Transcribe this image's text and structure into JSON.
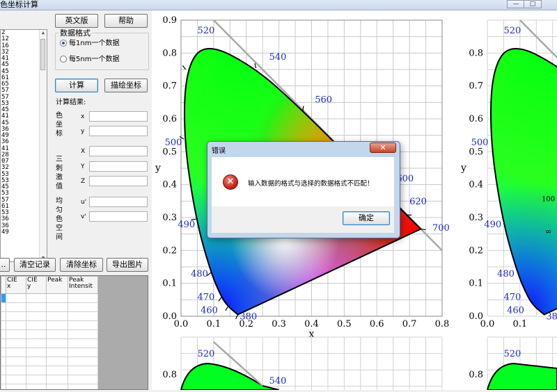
{
  "window": {
    "title": "色坐标计算",
    "controls": [
      "—",
      "□"
    ]
  },
  "data_list": [
    "2",
    "12",
    "16",
    "32",
    "41",
    "45",
    "45",
    "61",
    "65",
    "57",
    "57",
    "53",
    "45",
    "41",
    "45",
    "36",
    "49",
    "36",
    "41",
    "28",
    "07",
    "32",
    "53",
    "53",
    "45",
    "53",
    "57",
    "61",
    "53",
    "36",
    "36",
    "49"
  ],
  "buttons": {
    "english": "英文版",
    "help": "帮助",
    "calculate": "计算",
    "plot": "描绘坐标",
    "left_partial": "..",
    "clear_records": "清空记录",
    "clear_coords": "清除坐标",
    "export_image": "导出图片"
  },
  "data_format": {
    "legend": "数据格式",
    "options": [
      "每1nm一个数据",
      "每5nm一个数据"
    ],
    "selected": 0
  },
  "results": {
    "heading": "计算结果:",
    "groups": [
      {
        "label": "色坐标",
        "fields": [
          "x",
          "y"
        ]
      },
      {
        "label": "三刺激值",
        "fields": [
          "X",
          "Y",
          "Z"
        ]
      },
      {
        "label": "均匀色空间",
        "fields": [
          "u'",
          "v'"
        ]
      }
    ]
  },
  "table": {
    "headers": [
      "CIE\nx",
      "CIE\ny",
      "Peak",
      "Peak\nIntensit"
    ]
  },
  "chart_data": [
    {
      "type": "chromaticity-diagram",
      "xlabel": "x",
      "ylabel": "y",
      "xlim": [
        0,
        0.8
      ],
      "ylim": [
        0,
        0.9
      ],
      "xticks": [
        "0.0",
        "0.1",
        "0.2",
        "0.3",
        "0.4",
        "0.5",
        "0.6",
        "0.7",
        "0.8"
      ],
      "yticks": [
        "0.0",
        "0.1",
        "0.2",
        "0.3",
        "0.4",
        "0.5",
        "0.6",
        "0.7",
        "0.8",
        "0.9"
      ],
      "grid": true,
      "wavelength_labels": [
        "380",
        "460",
        "470",
        "480",
        "490",
        "500",
        "520",
        "540",
        "560",
        "600",
        "620",
        "700"
      ],
      "locus": [
        [
          0.1741,
          0.005
        ],
        [
          0.144,
          0.0297
        ],
        [
          0.1241,
          0.0578
        ],
        [
          0.0913,
          0.1327
        ],
        [
          0.0454,
          0.295
        ],
        [
          0.0082,
          0.5384
        ],
        [
          0.0139,
          0.7502
        ],
        [
          0.0743,
          0.8338
        ],
        [
          0.2296,
          0.7543
        ],
        [
          0.3731,
          0.6245
        ],
        [
          0.5125,
          0.4866
        ],
        [
          0.627,
          0.3725
        ],
        [
          0.6915,
          0.3083
        ],
        [
          0.7347,
          0.2653
        ]
      ],
      "tick_marks": [
        [
          0.1741,
          0.005
        ],
        [
          0.144,
          0.0297
        ],
        [
          0.1241,
          0.0578
        ],
        [
          0.0913,
          0.1327
        ],
        [
          0.0454,
          0.295
        ],
        [
          0.0082,
          0.5384
        ],
        [
          0.0139,
          0.7502
        ],
        [
          0.2296,
          0.7543
        ],
        [
          0.3731,
          0.6245
        ],
        [
          0.627,
          0.3725
        ],
        [
          0.6915,
          0.3083
        ],
        [
          0.7347,
          0.2653
        ]
      ]
    },
    {
      "type": "chromaticity-diagram",
      "xlabel": "",
      "ylabel": "y",
      "ylim": [
        0,
        0.9
      ],
      "yticks": [
        "0.0",
        "0.1",
        "0.2",
        "0.3",
        "0.4",
        "0.5",
        "0.6",
        "0.7",
        "0.8"
      ],
      "xticks": [
        "0.0",
        "0.1"
      ],
      "wavelength_labels": [
        "380",
        "460",
        "470",
        "480",
        "490",
        "500",
        "520"
      ],
      "annotations": [
        "100",
        "∞"
      ]
    },
    {
      "type": "chromaticity-diagram",
      "yticks": [
        "0.8"
      ],
      "wavelength_labels": [
        "520",
        "540"
      ]
    },
    {
      "type": "chromaticity-diagram",
      "yticks": [
        "0.8"
      ],
      "wavelength_labels": [
        "520"
      ]
    }
  ],
  "dialog": {
    "title": "错误",
    "close": "✕",
    "message": "输入数据的格式与选择的数据格式不匹配！",
    "ok": "确定"
  }
}
